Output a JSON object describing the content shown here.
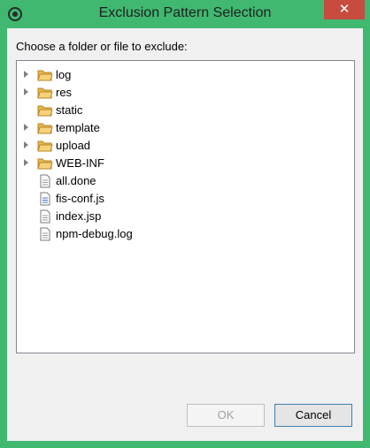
{
  "window": {
    "title": "Exclusion Pattern Selection",
    "close_label": "✕"
  },
  "dialog": {
    "prompt": "Choose a folder or file to exclude:",
    "tree": [
      {
        "label": "log",
        "type": "folder",
        "expandable": true
      },
      {
        "label": "res",
        "type": "folder",
        "expandable": true
      },
      {
        "label": "static",
        "type": "folder",
        "expandable": false
      },
      {
        "label": "template",
        "type": "folder",
        "expandable": true
      },
      {
        "label": "upload",
        "type": "folder",
        "expandable": true
      },
      {
        "label": "WEB-INF",
        "type": "folder",
        "expandable": true
      },
      {
        "label": "all.done",
        "type": "file",
        "expandable": false
      },
      {
        "label": "fis-conf.js",
        "type": "js-file",
        "expandable": false
      },
      {
        "label": "index.jsp",
        "type": "file",
        "expandable": false
      },
      {
        "label": "npm-debug.log",
        "type": "log-file",
        "expandable": false
      }
    ],
    "ok_label": "OK",
    "cancel_label": "Cancel",
    "ok_enabled": false
  },
  "colors": {
    "frame": "#40b870",
    "close": "#c74b3e",
    "folder": "#e8b84a"
  }
}
